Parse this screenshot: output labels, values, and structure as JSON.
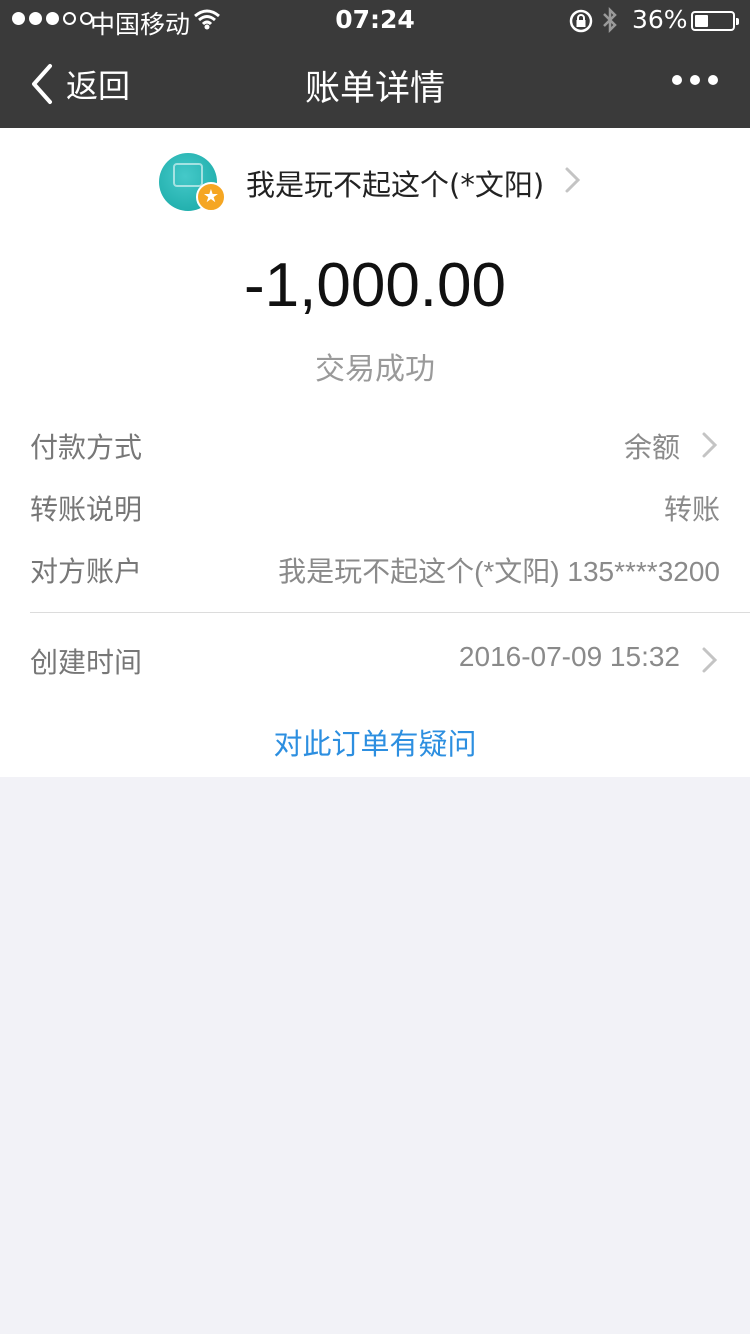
{
  "status_bar": {
    "carrier": "中国移动",
    "time": "07:24",
    "battery_percent": "36%",
    "battery_level": 0.36,
    "signal_bars_filled": 3,
    "signal_bars_total": 5
  },
  "nav": {
    "back_label": "返回",
    "title": "账单详情",
    "more_icon": "ellipsis-icon"
  },
  "merchant": {
    "name": "我是玩不起这个(*文阳)",
    "avatar_color": "#1fb3b0",
    "badge_color": "#f5a623",
    "badge_icon": "star-icon"
  },
  "transaction": {
    "amount": "-1,000.00",
    "status": "交易成功"
  },
  "details": [
    {
      "label": "付款方式",
      "value": "余额"
    },
    {
      "label": "转账说明",
      "value": "转账"
    },
    {
      "label": "对方账户",
      "value": "我是玩不起这个(*文阳) 135****3200"
    },
    {
      "label": "创建时间",
      "value": "2016-07-09 15:32"
    }
  ],
  "question_link": "对此订单有疑问",
  "colors": {
    "nav_background": "#3a3a3a",
    "link": "#2d8fe0",
    "page_background": "#f2f2f7"
  }
}
